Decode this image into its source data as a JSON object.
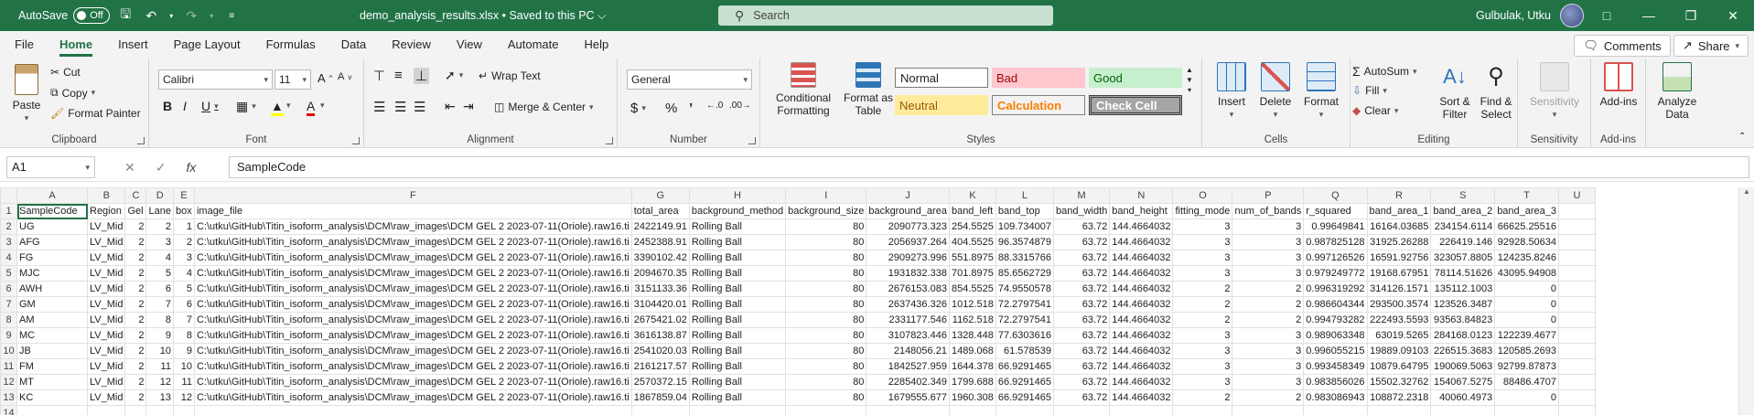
{
  "titlebar": {
    "autosave_label": "AutoSave",
    "autosave_state": "Off",
    "doc_title": "demo_analysis_results.xlsx  •  Saved to this PC ⌵",
    "search_placeholder": "Search",
    "user_name": "Gulbulak, Utku",
    "accent": "#217346"
  },
  "tabs": [
    "File",
    "Home",
    "Insert",
    "Page Layout",
    "Formulas",
    "Data",
    "Review",
    "View",
    "Automate",
    "Help"
  ],
  "active_tab": "Home",
  "comments_label": "Comments",
  "share_label": "Share",
  "ribbon": {
    "clipboard": {
      "paste": "Paste",
      "cut": "Cut",
      "copy": "Copy",
      "format_painter": "Format Painter",
      "label": "Clipboard"
    },
    "font": {
      "name": "Calibri",
      "size": "11",
      "label": "Font"
    },
    "alignment": {
      "wrap": "Wrap Text",
      "merge": "Merge & Center",
      "label": "Alignment"
    },
    "number": {
      "format": "General",
      "label": "Number"
    },
    "styles": {
      "conditional": "Conditional Formatting",
      "format_table": "Format as Table",
      "normal": "Normal",
      "bad": "Bad",
      "good": "Good",
      "neutral": "Neutral",
      "calculation": "Calculation",
      "check_cell": "Check Cell",
      "label": "Styles"
    },
    "cells": {
      "insert": "Insert",
      "delete": "Delete",
      "format": "Format",
      "label": "Cells"
    },
    "editing": {
      "autosum": "AutoSum",
      "fill": "Fill",
      "clear": "Clear",
      "sort": "Sort & Filter",
      "find": "Find & Select",
      "label": "Editing"
    },
    "sensitivity": {
      "btn": "Sensitivity",
      "label": "Sensitivity"
    },
    "addins": {
      "btn": "Add-ins",
      "label": "Add-ins"
    },
    "analyze": {
      "btn": "Analyze Data"
    }
  },
  "formula_bar": {
    "namebox": "A1",
    "fx": "fx",
    "formula": "SampleCode"
  },
  "columns": [
    "A",
    "B",
    "C",
    "D",
    "E",
    "F",
    "G",
    "H",
    "I",
    "J",
    "K",
    "L",
    "M",
    "N",
    "O",
    "P",
    "Q",
    "R",
    "S",
    "T",
    "U"
  ],
  "headers": [
    "SampleCode",
    "Region",
    "Gel",
    "Lane",
    "box",
    "image_file",
    "total_area",
    "background_method",
    "background_size",
    "background_area",
    "band_left",
    "band_top",
    "band_width",
    "band_height",
    "fitting_mode",
    "num_of_bands",
    "r_squared",
    "band_area_1",
    "band_area_2",
    "band_area_3",
    ""
  ],
  "rows": [
    [
      "UG",
      "LV_Mid",
      "2",
      "2",
      "1",
      "C:\\utku\\GitHub\\Titin_isoform_analysis\\DCM\\raw_images\\DCM GEL 2 2023-07-11(Oriole).raw16.ti",
      "2422149.91",
      "Rolling Ball",
      "80",
      "2090773.323",
      "254.5525",
      "109.734007",
      "63.72",
      "144.4664032",
      "3",
      "3",
      "0.99649841",
      "16164.03685",
      "234154.6114",
      "66625.25516",
      ""
    ],
    [
      "AFG",
      "LV_Mid",
      "2",
      "3",
      "2",
      "C:\\utku\\GitHub\\Titin_isoform_analysis\\DCM\\raw_images\\DCM GEL 2 2023-07-11(Oriole).raw16.ti",
      "2452388.91",
      "Rolling Ball",
      "80",
      "2056937.264",
      "404.5525",
      "96.3574879",
      "63.72",
      "144.4664032",
      "3",
      "3",
      "0.987825128",
      "31925.26288",
      "226419.146",
      "92928.50634",
      ""
    ],
    [
      "FG",
      "LV_Mid",
      "2",
      "4",
      "3",
      "C:\\utku\\GitHub\\Titin_isoform_analysis\\DCM\\raw_images\\DCM GEL 2 2023-07-11(Oriole).raw16.ti",
      "3390102.42",
      "Rolling Ball",
      "80",
      "2909273.996",
      "551.8975",
      "88.3315766",
      "63.72",
      "144.4664032",
      "3",
      "3",
      "0.997126526",
      "16591.92756",
      "323057.8805",
      "124235.8246",
      ""
    ],
    [
      "MJC",
      "LV_Mid",
      "2",
      "5",
      "4",
      "C:\\utku\\GitHub\\Titin_isoform_analysis\\DCM\\raw_images\\DCM GEL 2 2023-07-11(Oriole).raw16.ti",
      "2094670.35",
      "Rolling Ball",
      "80",
      "1931832.338",
      "701.8975",
      "85.6562729",
      "63.72",
      "144.4664032",
      "3",
      "3",
      "0.979249772",
      "19168.67951",
      "78114.51626",
      "43095.94908",
      ""
    ],
    [
      "AWH",
      "LV_Mid",
      "2",
      "6",
      "5",
      "C:\\utku\\GitHub\\Titin_isoform_analysis\\DCM\\raw_images\\DCM GEL 2 2023-07-11(Oriole).raw16.ti",
      "3151133.36",
      "Rolling Ball",
      "80",
      "2676153.083",
      "854.5525",
      "74.9550578",
      "63.72",
      "144.4664032",
      "2",
      "2",
      "0.996319292",
      "314126.1571",
      "135112.1003",
      "0",
      ""
    ],
    [
      "GM",
      "LV_Mid",
      "2",
      "7",
      "6",
      "C:\\utku\\GitHub\\Titin_isoform_analysis\\DCM\\raw_images\\DCM GEL 2 2023-07-11(Oriole).raw16.ti",
      "3104420.01",
      "Rolling Ball",
      "80",
      "2637436.326",
      "1012.518",
      "72.2797541",
      "63.72",
      "144.4664032",
      "2",
      "2",
      "0.986604344",
      "293500.3574",
      "123526.3487",
      "0",
      ""
    ],
    [
      "AM",
      "LV_Mid",
      "2",
      "8",
      "7",
      "C:\\utku\\GitHub\\Titin_isoform_analysis\\DCM\\raw_images\\DCM GEL 2 2023-07-11(Oriole).raw16.ti",
      "2675421.02",
      "Rolling Ball",
      "80",
      "2331177.546",
      "1162.518",
      "72.2797541",
      "63.72",
      "144.4664032",
      "2",
      "2",
      "0.994793282",
      "222493.5593",
      "93563.84823",
      "0",
      ""
    ],
    [
      "MC",
      "LV_Mid",
      "2",
      "9",
      "8",
      "C:\\utku\\GitHub\\Titin_isoform_analysis\\DCM\\raw_images\\DCM GEL 2 2023-07-11(Oriole).raw16.ti",
      "3616138.87",
      "Rolling Ball",
      "80",
      "3107823.446",
      "1328.448",
      "77.6303616",
      "63.72",
      "144.4664032",
      "3",
      "3",
      "0.989063348",
      "63019.5265",
      "284168.0123",
      "122239.4677",
      ""
    ],
    [
      "JB",
      "LV_Mid",
      "2",
      "10",
      "9",
      "C:\\utku\\GitHub\\Titin_isoform_analysis\\DCM\\raw_images\\DCM GEL 2 2023-07-11(Oriole).raw16.ti",
      "2541020.03",
      "Rolling Ball",
      "80",
      "2148056.21",
      "1489.068",
      "61.578539",
      "63.72",
      "144.4664032",
      "3",
      "3",
      "0.996055215",
      "19889.09103",
      "226515.3683",
      "120585.2693",
      ""
    ],
    [
      "FM",
      "LV_Mid",
      "2",
      "11",
      "10",
      "C:\\utku\\GitHub\\Titin_isoform_analysis\\DCM\\raw_images\\DCM GEL 2 2023-07-11(Oriole).raw16.ti",
      "2161217.57",
      "Rolling Ball",
      "80",
      "1842527.959",
      "1644.378",
      "66.9291465",
      "63.72",
      "144.4664032",
      "3",
      "3",
      "0.993458349",
      "10879.64795",
      "190069.5063",
      "92799.87873",
      ""
    ],
    [
      "MT",
      "LV_Mid",
      "2",
      "12",
      "11",
      "C:\\utku\\GitHub\\Titin_isoform_analysis\\DCM\\raw_images\\DCM GEL 2 2023-07-11(Oriole).raw16.ti",
      "2570372.15",
      "Rolling Ball",
      "80",
      "2285402.349",
      "1799.688",
      "66.9291465",
      "63.72",
      "144.4664032",
      "3",
      "3",
      "0.983856026",
      "15502.32762",
      "154067.5275",
      "88486.4707",
      ""
    ],
    [
      "KC",
      "LV_Mid",
      "2",
      "13",
      "12",
      "C:\\utku\\GitHub\\Titin_isoform_analysis\\DCM\\raw_images\\DCM GEL 2 2023-07-11(Oriole).raw16.ti",
      "1867859.04",
      "Rolling Ball",
      "80",
      "1679555.677",
      "1960.308",
      "66.9291465",
      "63.72",
      "144.4664032",
      "2",
      "2",
      "0.983086943",
      "108872.2318",
      "40060.4973",
      "0",
      ""
    ]
  ]
}
